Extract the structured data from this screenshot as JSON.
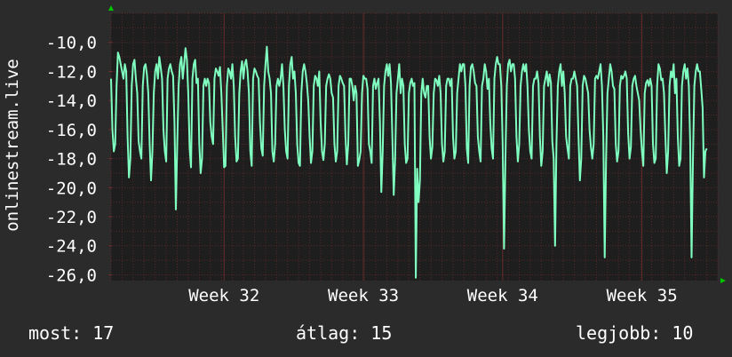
{
  "colors": {
    "background": "#2b2b2b",
    "plot_background": "#1e1e1e",
    "grid": "#6e2d2d",
    "line": "#7fffc0",
    "axis_arrow": "#00c800",
    "text": "#ffffff"
  },
  "chart_data": {
    "type": "line",
    "title": "",
    "ylabel": "onlinestream.live",
    "xlabel": "",
    "ylim": [
      -26.4,
      -8.0
    ],
    "xlim": [
      0,
      440
    ],
    "grid": true,
    "y_ticks": [
      {
        "value": -10,
        "label": "-10,0"
      },
      {
        "value": -12,
        "label": "-12,0"
      },
      {
        "value": -14,
        "label": "-14,0"
      },
      {
        "value": -16,
        "label": "-16,0"
      },
      {
        "value": -18,
        "label": "-18,0"
      },
      {
        "value": -20,
        "label": "-20,0"
      },
      {
        "value": -22,
        "label": "-22,0"
      },
      {
        "value": -24,
        "label": "-24,0"
      },
      {
        "value": -26,
        "label": "-26,0"
      }
    ],
    "x_ticks": [
      {
        "value": 82,
        "label": "Week 32"
      },
      {
        "value": 183,
        "label": "Week 33"
      },
      {
        "value": 284,
        "label": "Week 34"
      },
      {
        "value": 385,
        "label": "Week 35"
      }
    ],
    "series": [
      {
        "values": [
          -12.5,
          -16,
          -17.5,
          -17,
          -13,
          -10.7,
          -11,
          -11.5,
          -12,
          -12.5,
          -11.5,
          -12,
          -16.5,
          -19.3,
          -18,
          -13,
          -11.5,
          -11.2,
          -12.5,
          -13.5,
          -16.8,
          -17.5,
          -18,
          -13,
          -11.7,
          -11.5,
          -12.2,
          -13.5,
          -17,
          -19.5,
          -17.5,
          -13.5,
          -12,
          -11.5,
          -12.5,
          -11,
          -11.7,
          -12.5,
          -16,
          -17.5,
          -18.2,
          -12.5,
          -11.8,
          -11.5,
          -12,
          -12.3,
          -15.5,
          -21.5,
          -17,
          -13,
          -11.5,
          -11,
          -12.5,
          -11.5,
          -10.4,
          -11.2,
          -13.5,
          -17.3,
          -18.6,
          -12.5,
          -11.5,
          -11.2,
          -12.8,
          -12.5,
          -17,
          -19,
          -18,
          -13,
          -12.5,
          -13,
          -12.5,
          -12.8,
          -15.5,
          -16.5,
          -17,
          -12.5,
          -11.8,
          -12,
          -12.3,
          -11.7,
          -13.5,
          -16,
          -18.6,
          -18.5,
          -13,
          -11.8,
          -12,
          -12.5,
          -11.5,
          -13,
          -16.5,
          -18.2,
          -18,
          -13.5,
          -12,
          -11.3,
          -12.5,
          -11.5,
          -11.2,
          -12,
          -13.5,
          -17.5,
          -18.5,
          -12.5,
          -11.8,
          -12,
          -12.3,
          -12.5,
          -15.5,
          -17.3,
          -17.8,
          -13,
          -11.5,
          -10.3,
          -12,
          -12.5,
          -13.5,
          -17.5,
          -18.2,
          -17,
          -13,
          -12.5,
          -13,
          -12.5,
          -11.5,
          -13,
          -16,
          -17.5,
          -18,
          -13,
          -11.5,
          -11,
          -12.5,
          -12,
          -13.5,
          -17,
          -18.3,
          -18.5,
          -13.5,
          -12,
          -11.5,
          -12,
          -12.8,
          -14,
          -16.5,
          -18.3,
          -17.5,
          -13,
          -12.3,
          -12.5,
          -13,
          -12,
          -15.5,
          -17.5,
          -18.1,
          -17,
          -13,
          -12.5,
          -12.2,
          -12.5,
          -13.5,
          -13.8,
          -17,
          -18.2,
          -17.5,
          -13,
          -12.3,
          -12.5,
          -12.8,
          -13,
          -16.5,
          -18.4,
          -17,
          -12.5,
          -12.5,
          -13,
          -14,
          -13,
          -13.5,
          -18.5,
          -18.1,
          -17.5,
          -13.5,
          -12.3,
          -12.5,
          -12.5,
          -13.2,
          -17,
          -17.5,
          -18.3,
          -13,
          -12.5,
          -13.2,
          -12.8,
          -12.5,
          -15.5,
          -20.3,
          -17.5,
          -13,
          -12,
          -11.5,
          -12.3,
          -11.5,
          -12.8,
          -16.5,
          -20.5,
          -18.1,
          -13.5,
          -12.5,
          -11.5,
          -13.5,
          -12.5,
          -13,
          -17,
          -18.3,
          -18,
          -13.5,
          -12.8,
          -12.5,
          -13,
          -12.8,
          -26.2,
          -18.7,
          -21,
          -19.5,
          -13.5,
          -12.5,
          -13.5,
          -13.8,
          -13,
          -13,
          -16.5,
          -18,
          -17.2,
          -13.5,
          -12.5,
          -12.6,
          -13,
          -12.3,
          -13.5,
          -17,
          -18.2,
          -17.5,
          -13,
          -12.5,
          -12.5,
          -13,
          -12.5,
          -16.5,
          -18,
          -17.5,
          -13.5,
          -12.5,
          -11.5,
          -12,
          -11.5,
          -11.5,
          -13,
          -17.3,
          -18.3,
          -13,
          -11.7,
          -11.5,
          -12,
          -12.8,
          -13,
          -16.5,
          -17.5,
          -18.2,
          -13,
          -12.5,
          -11.5,
          -12,
          -13.2,
          -12.5,
          -15.5,
          -17.3,
          -18,
          -12.5,
          -11.5,
          -11,
          -11.5,
          -11.5,
          -13,
          -17,
          -24.2,
          -18,
          -13,
          -11.5,
          -11.2,
          -12,
          -11.5,
          -11.5,
          -12.5,
          -16.5,
          -18.2,
          -17,
          -13,
          -12,
          -11.5,
          -12,
          -11.5,
          -13,
          -16,
          -17.5,
          -18,
          -13,
          -12.5,
          -12.5,
          -12,
          -12.8,
          -16.5,
          -18.5,
          -17.5,
          -13,
          -12.5,
          -12,
          -13,
          -12.2,
          -12.8,
          -16.8,
          -18,
          -24,
          -17,
          -13,
          -12,
          -11.5,
          -13,
          -12,
          -13.5,
          -16.5,
          -17.3,
          -18,
          -13,
          -12.5,
          -12.5,
          -12,
          -12.5,
          -13,
          -16.5,
          -19.5,
          -18,
          -13,
          -12.3,
          -12.5,
          -13,
          -13.5,
          -16,
          -17.2,
          -18,
          -17,
          -12.5,
          -12.3,
          -12.5,
          -12,
          -11.5,
          -13,
          -16.5,
          -24.8,
          -18,
          -13.5,
          -12.5,
          -11.5,
          -12,
          -13,
          -13.2,
          -17,
          -18.2,
          -17.5,
          -13,
          -12.3,
          -12.5,
          -12.3,
          -12,
          -12.5,
          -16.3,
          -18,
          -17.2,
          -13,
          -12.5,
          -12.3,
          -13,
          -13.5,
          -14,
          -16,
          -17.5,
          -18.5,
          -13.5,
          -12.8,
          -12.6,
          -13,
          -12.5,
          -13,
          -17,
          -18.3,
          -18,
          -13,
          -11.5,
          -11.8,
          -12.6,
          -12.5,
          -13.5,
          -16.5,
          -19,
          -17.5,
          -13,
          -12,
          -12.4,
          -11.5,
          -13.5,
          -12.5,
          -16.5,
          -18.5,
          -18,
          -13,
          -12,
          -11.5,
          -12.5,
          -11.8,
          -13,
          -17,
          -24.8,
          -18,
          -13,
          -12,
          -11.5,
          -12,
          -12,
          -13.2,
          -14.5,
          -19.3,
          -17.5,
          -17.3
        ]
      }
    ]
  },
  "stats": {
    "current": "most: 17",
    "average": "átlag: 15",
    "best": "legjobb: 10"
  }
}
